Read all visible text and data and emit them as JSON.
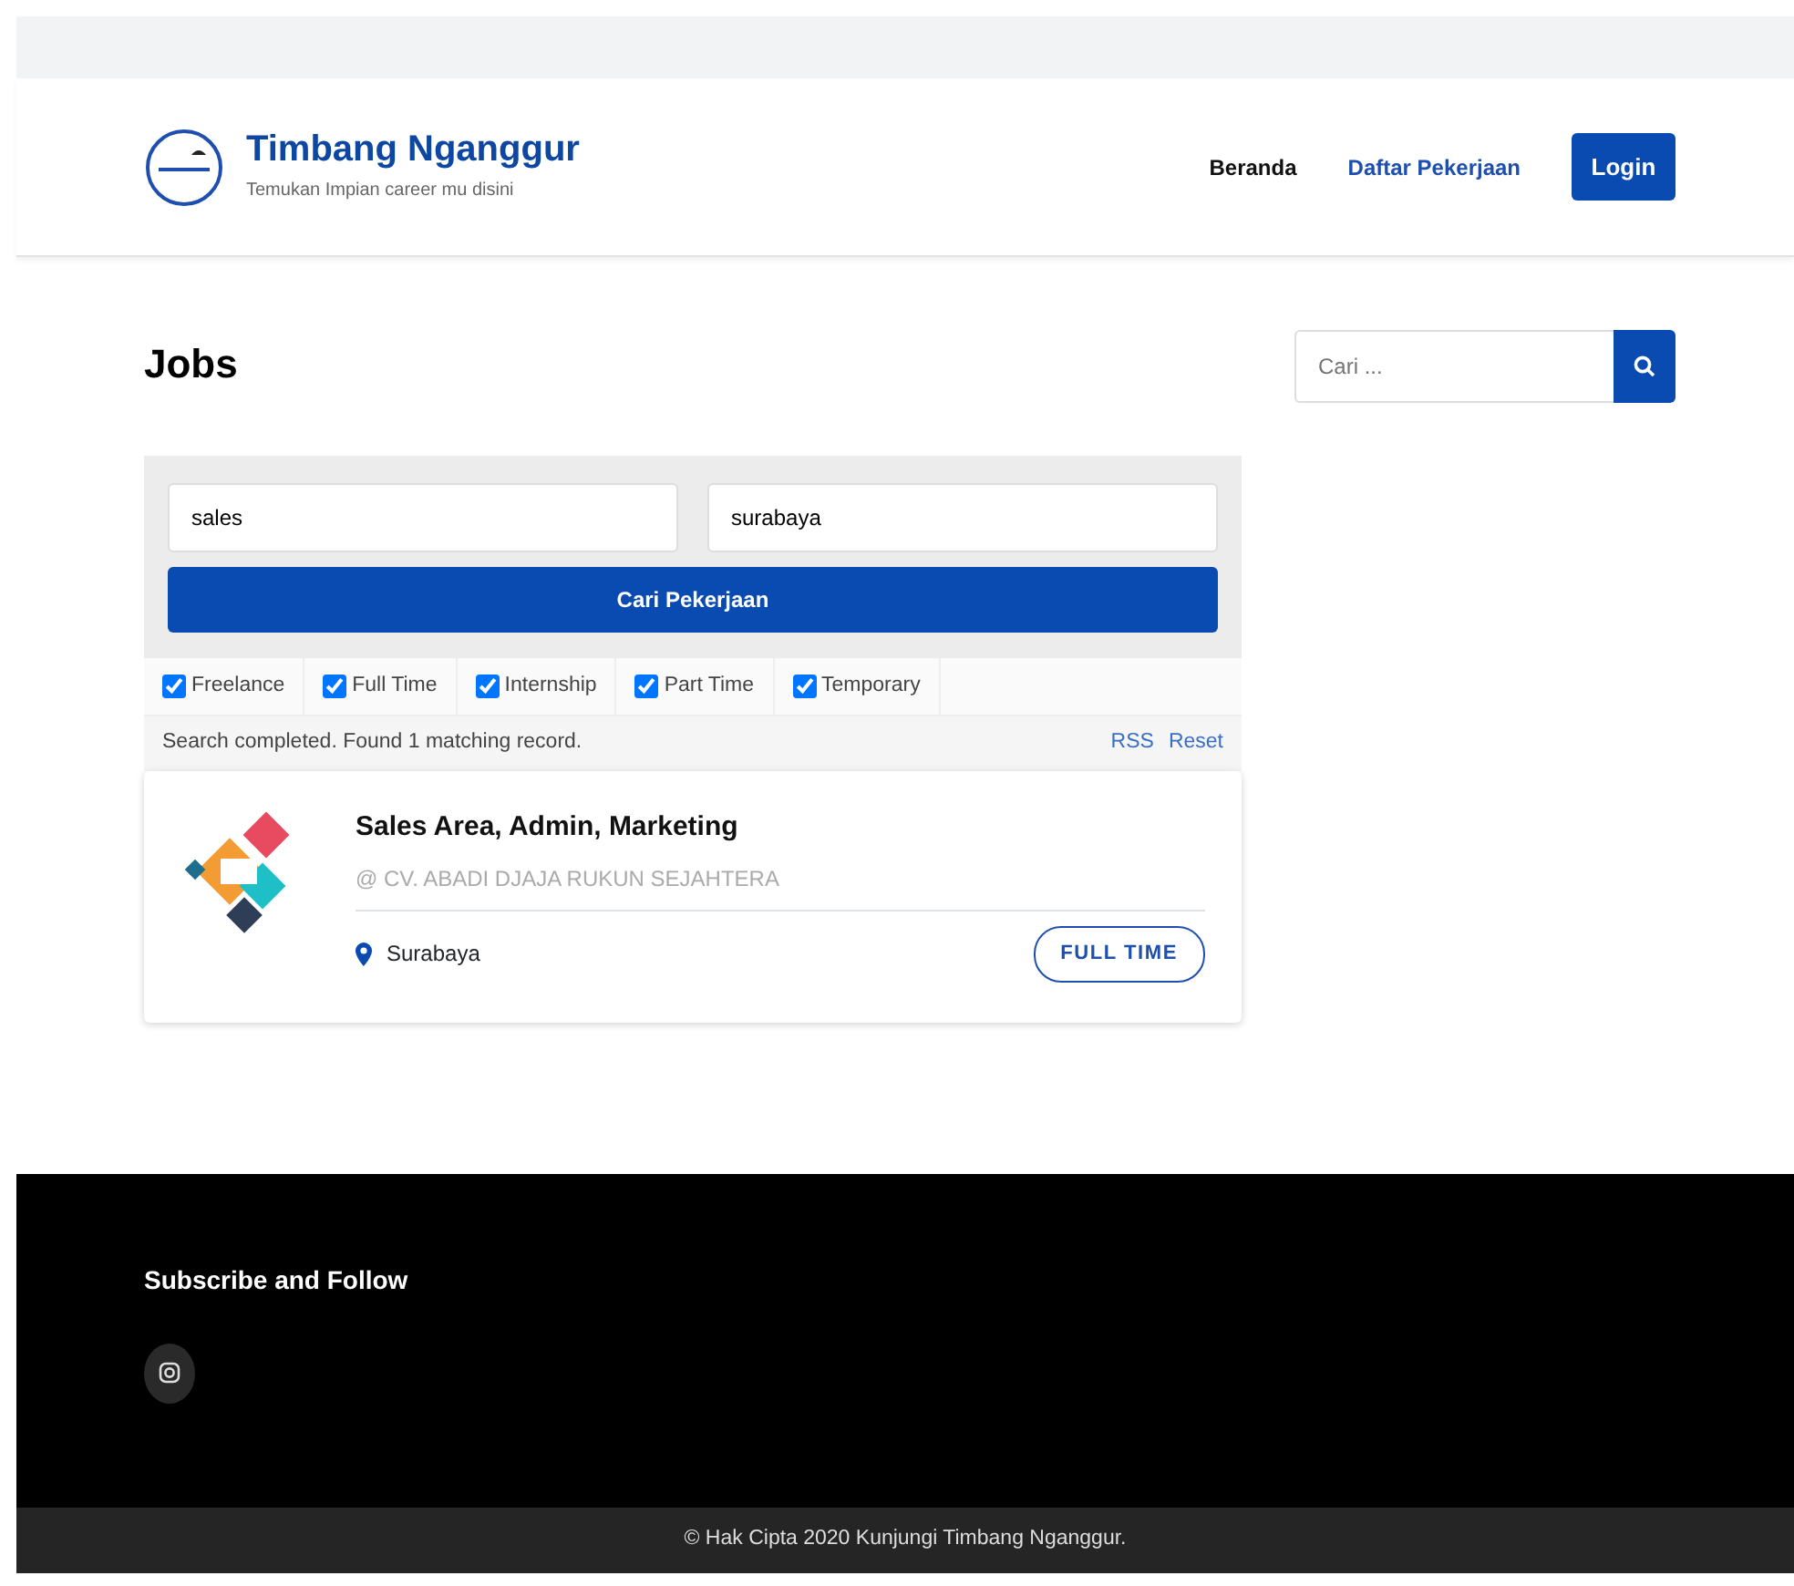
{
  "brand": {
    "title": "Timbang Nganggur",
    "tagline": "Temukan Impian career mu disini"
  },
  "nav": [
    {
      "label": "Beranda",
      "selected": false
    },
    {
      "label": "Daftar Pekerjaan",
      "selected": true
    }
  ],
  "login_button": "Login",
  "page_title": "Jobs",
  "sidebar_search": {
    "placeholder": "Cari ..."
  },
  "job_search": {
    "keywords": "sales",
    "location": "surabaya",
    "button": "Cari Pekerjaan"
  },
  "job_types": [
    {
      "label": "Freelance",
      "checked": true
    },
    {
      "label": "Full Time",
      "checked": true
    },
    {
      "label": "Internship",
      "checked": true
    },
    {
      "label": "Part Time",
      "checked": true
    },
    {
      "label": "Temporary",
      "checked": true
    }
  ],
  "results": {
    "message": "Search completed. Found 1 matching record.",
    "links": [
      "RSS",
      "Reset"
    ]
  },
  "jobs": [
    {
      "title": "Sales Area, Admin, Marketing",
      "company": "@ CV. ABADI DJAJA RUKUN SEJAHTERA",
      "location": "Surabaya",
      "type": "FULL TIME"
    }
  ],
  "footer": {
    "heading": "Subscribe and Follow",
    "copyright": "© Hak Cipta 2020 Kunjungi Timbang Nganggur."
  }
}
